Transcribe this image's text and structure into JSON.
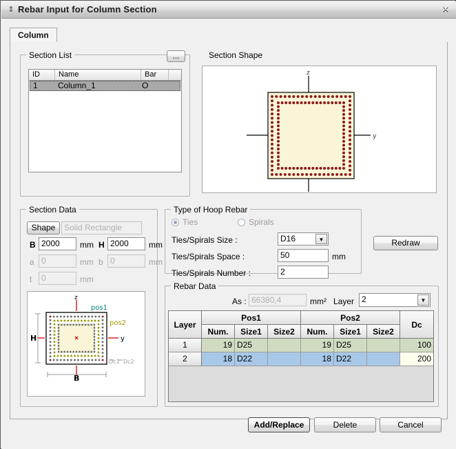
{
  "window": {
    "title": "Rebar Input for Column Section",
    "close_label": "×",
    "grip_icon": "resize-grip-icon"
  },
  "tab": {
    "label": "Column"
  },
  "section_list": {
    "title": "Section List",
    "browse_label": "...",
    "columns": [
      "ID",
      "Name",
      "Bar"
    ],
    "rows": [
      {
        "id": "1",
        "name": "Column_1",
        "bar": "O"
      }
    ]
  },
  "section_shape": {
    "title": "Section Shape",
    "axis_z": "z",
    "axis_y": "y",
    "rebar_color": "#8b1a1a",
    "fill_color": "#fbf5d8"
  },
  "section_data": {
    "title": "Section Data",
    "shape_label": "Shape",
    "shape_value": "Solid Rectangle",
    "b_label": "B",
    "b_value": "2000",
    "b_unit": "mm",
    "h_label": "H",
    "h_value": "2000",
    "h_unit": "mm",
    "a_label": "a",
    "a_value": "0",
    "a_unit": "mm",
    "bb_label": "b",
    "bb_value": "0",
    "bb_unit": "mm",
    "t_label": "t",
    "t_value": "0",
    "t_unit": "mm",
    "diagram": {
      "axis_z": "z",
      "axis_y": "y",
      "pos1": "pos1",
      "pos2": "pos2",
      "h": "H",
      "b": "B",
      "dc1": "Dc1",
      "dc2": "Dc2",
      "pos1_color": "#008080",
      "pos2_color": "#999900"
    }
  },
  "hoop": {
    "title": "Type of Hoop Rebar",
    "ties_label": "Ties",
    "spirals_label": "Spirals",
    "selected": "Ties",
    "size_label": "Ties/Spirals Size :",
    "size_value": "D16",
    "space_label": "Ties/Spirals Space :",
    "space_value": "50",
    "space_unit": "mm",
    "number_label": "Ties/Spirals Number :",
    "number_value": "2"
  },
  "redraw": {
    "label": "Redraw"
  },
  "rebar_data": {
    "title": "Rebar Data",
    "as_label": "As :",
    "as_value": "66380,4",
    "as_unit": "mm²",
    "layer_label": "Layer",
    "layer_value": "2",
    "header": {
      "layer": "Layer",
      "pos1": "Pos1",
      "pos2": "Pos2",
      "dc": "Dc",
      "num": "Num.",
      "size1": "Size1",
      "size2": "Size2"
    },
    "rows": [
      {
        "layer": "1",
        "p1_num": "19",
        "p1_size1": "D25",
        "p1_size2": "",
        "p2_num": "19",
        "p2_size1": "D25",
        "p2_size2": "",
        "dc": "100",
        "color": "#cfdcc2",
        "dc_color": "#cfdcc2"
      },
      {
        "layer": "2",
        "p1_num": "18",
        "p1_size1": "D22",
        "p1_size2": "",
        "p2_num": "18",
        "p2_size1": "D22",
        "p2_size2": "",
        "dc": "200",
        "color": "#a8c8e8",
        "dc_color": "#fffeee"
      }
    ]
  },
  "footer": {
    "add_replace_label": "Add/Replace",
    "delete_label": "Delete",
    "cancel_label": "Cancel"
  }
}
